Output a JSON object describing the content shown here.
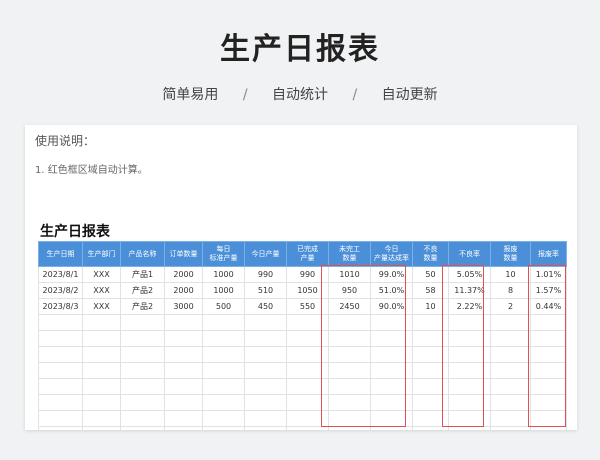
{
  "header": {
    "title": "生产日报表",
    "tags": [
      "简单易用",
      "自动统计",
      "自动更新"
    ],
    "separator": "/"
  },
  "usage": {
    "title": "使用说明：",
    "note": "1. 红色框区域自动计算。"
  },
  "report": {
    "title": "生产日报表",
    "columns": [
      "生产日期",
      "生产部门",
      "产品名称",
      "订单数量",
      "每日\n标准产量",
      "今日产量",
      "已完成\n产量",
      "未完工\n数量",
      "今日\n产量达成率",
      "不良\n数量",
      "不良率",
      "报废\n数量",
      "报废率"
    ],
    "rows": [
      [
        "2023/8/1",
        "XXX",
        "产品1",
        "2000",
        "1000",
        "990",
        "990",
        "1010",
        "99.0%",
        "50",
        "5.05%",
        "10",
        "1.01%"
      ],
      [
        "2023/8/2",
        "XXX",
        "产品2",
        "2000",
        "1000",
        "510",
        "1050",
        "950",
        "51.0%",
        "58",
        "11.37%",
        "8",
        "1.57%"
      ],
      [
        "2023/8/3",
        "XXX",
        "产品2",
        "3000",
        "500",
        "450",
        "550",
        "2450",
        "90.0%",
        "10",
        "2.22%",
        "2",
        "0.44%"
      ]
    ],
    "empty_rows": 8,
    "highlight_color": "#e05050",
    "header_color": "#4a8fd8"
  }
}
